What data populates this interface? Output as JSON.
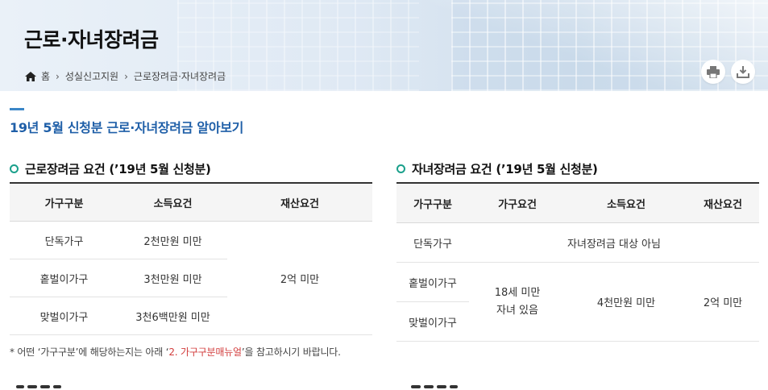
{
  "header": {
    "title": "근로·자녀장려금",
    "breadcrumb": [
      "홈",
      "성실신고지원",
      "근로장려금·자녀장려금"
    ]
  },
  "icons": {
    "home": "home-icon",
    "print": "printer-icon",
    "download": "download-icon"
  },
  "colors": {
    "accent": "#1f5fa8",
    "ring": "#1aa08b",
    "highlight": "#d23c3c"
  },
  "section": {
    "title": "19년 5월 신청분 근로·자녀장려금 알아보기"
  },
  "left": {
    "heading": "근로장려금 요건 (’19년 5월 신청분)",
    "columns": [
      "가구구분",
      "소득요건",
      "재산요건"
    ],
    "rows": [
      {
        "type": "단독가구",
        "income": "2천만원 미만"
      },
      {
        "type": "홑벌이가구",
        "income": "3천만원 미만"
      },
      {
        "type": "맞벌이가구",
        "income": "3천6백만원 미만"
      }
    ],
    "asset": "2억 미만"
  },
  "right": {
    "heading": "자녀장려금 요건 (’19년 5월 신청분)",
    "columns": [
      "가구구분",
      "가구요건",
      "소득요건",
      "재산요건"
    ],
    "rows": [
      "단독가구",
      "홑벌이가구",
      "맞벌이가구"
    ],
    "notEligible": "자녀장려금 대상 아님",
    "household_line1": "18세 미만",
    "household_line2": "자녀 있음",
    "income": "4천만원 미만",
    "asset": "2억 미만"
  },
  "footnote": {
    "prefix": "* 어떤 ‘가구구분’에 해당하는지는 아래 ‘",
    "link": "2. 가구구분매뉴얼",
    "suffix": "’을 참고하시기 바랍니다."
  }
}
